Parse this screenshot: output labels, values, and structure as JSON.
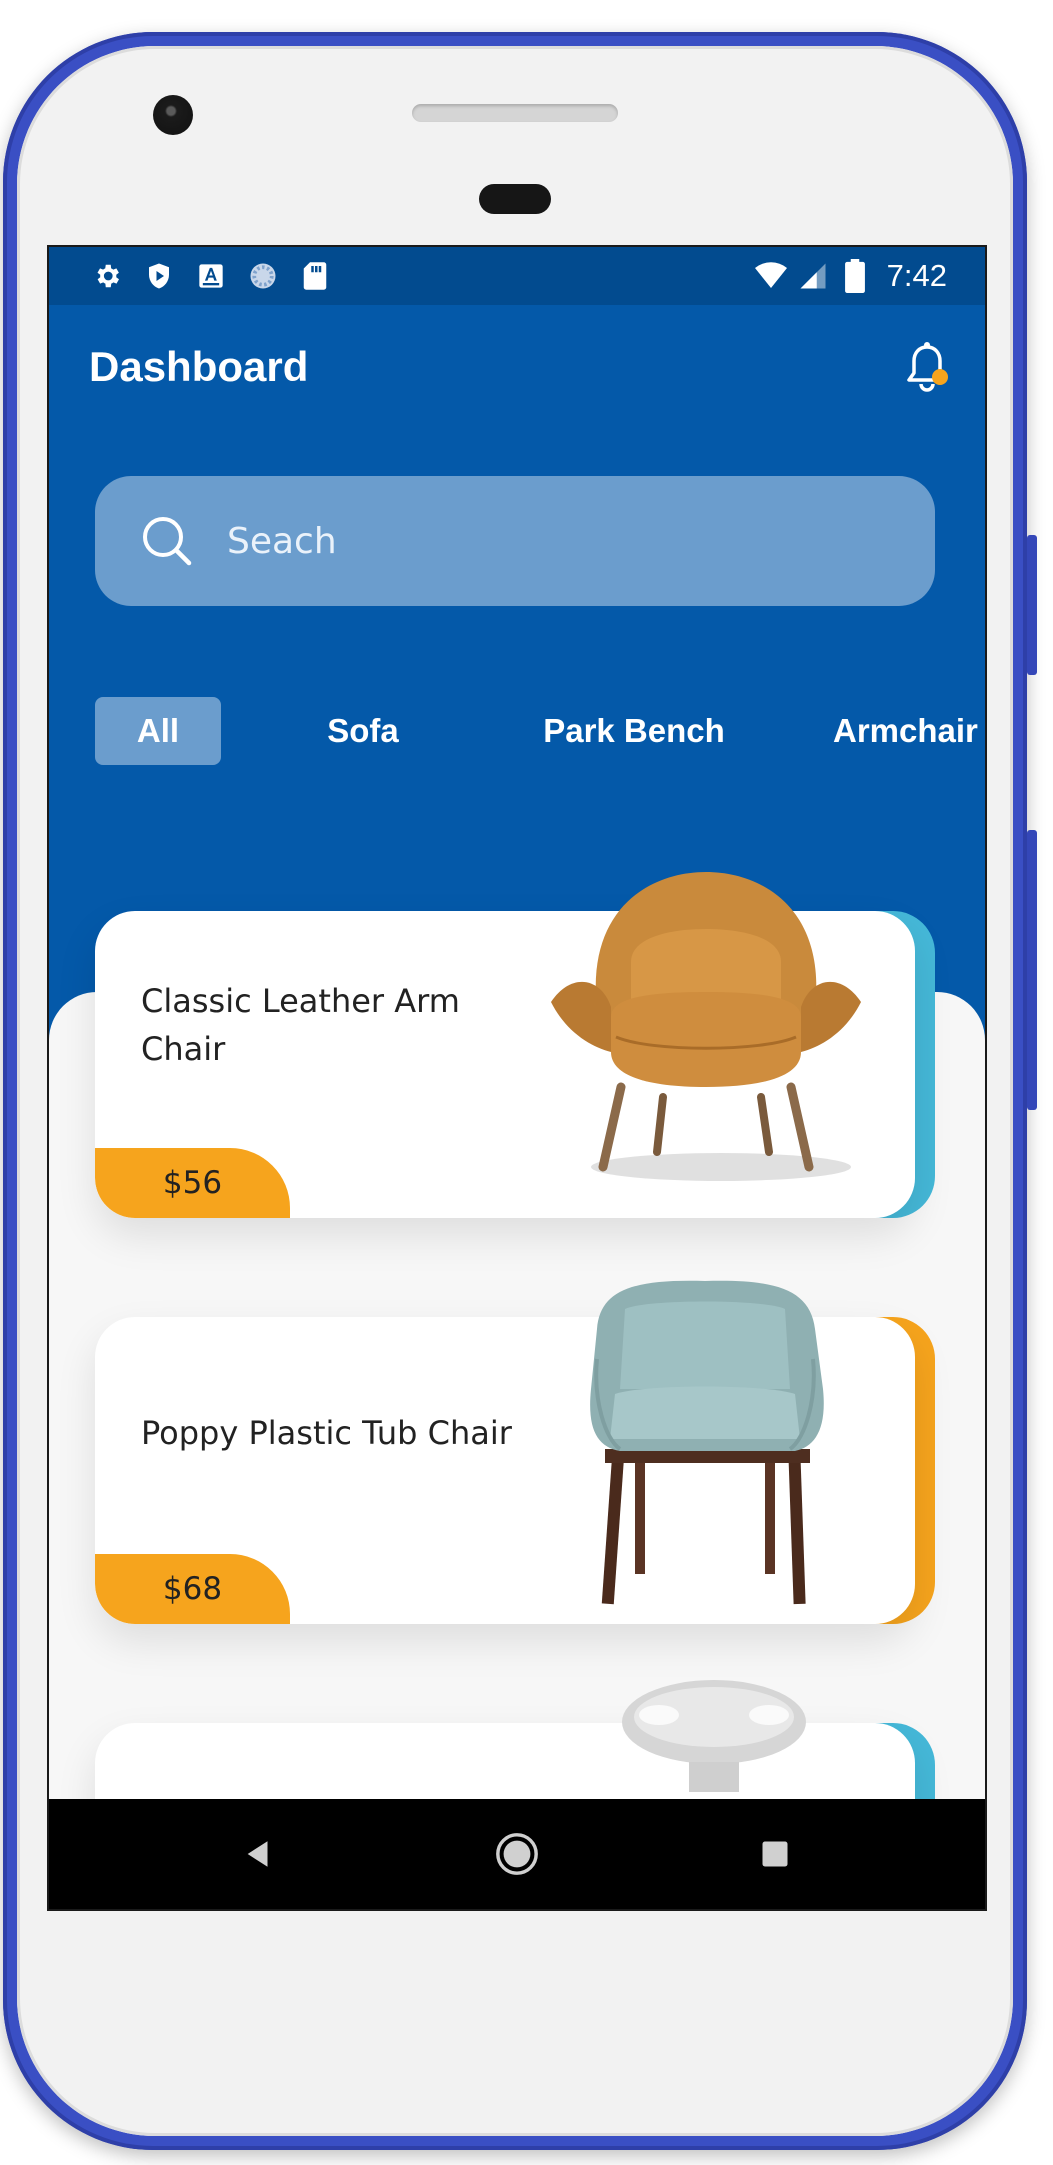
{
  "statusbar": {
    "left_icons": [
      "gear-icon",
      "shield-play-icon",
      "a-box-icon",
      "spinner-icon",
      "sd-card-icon"
    ],
    "right_icons": [
      "wifi-icon",
      "signal-icon",
      "battery-icon"
    ],
    "time": "7:42"
  },
  "appbar": {
    "title": "Dashboard",
    "notification_icon": "bell-icon",
    "notification_dot_color": "#f6a41d"
  },
  "search": {
    "placeholder": "Seach"
  },
  "tabs": [
    {
      "label": "All",
      "active": true
    },
    {
      "label": "Sofa",
      "active": false
    },
    {
      "label": "Park Bench",
      "active": false
    },
    {
      "label": "Armchair",
      "active": false
    }
  ],
  "products": [
    {
      "title": "Classic Leather Arm Chair",
      "price": "$56",
      "accent": "#45b8d8"
    },
    {
      "title": "Poppy Plastic Tub Chair",
      "price": "$68",
      "accent": "#f6a41d"
    },
    {
      "title": "",
      "price": "",
      "accent": "#45b8d8"
    }
  ],
  "navbar": {
    "back": "back-icon",
    "home": "home-icon",
    "recents": "recents-icon"
  },
  "colors": {
    "primary": "#0459a9",
    "statusbar": "#024b8f",
    "search_bg": "#6b9dcd",
    "price_tag": "#f6a41d"
  }
}
